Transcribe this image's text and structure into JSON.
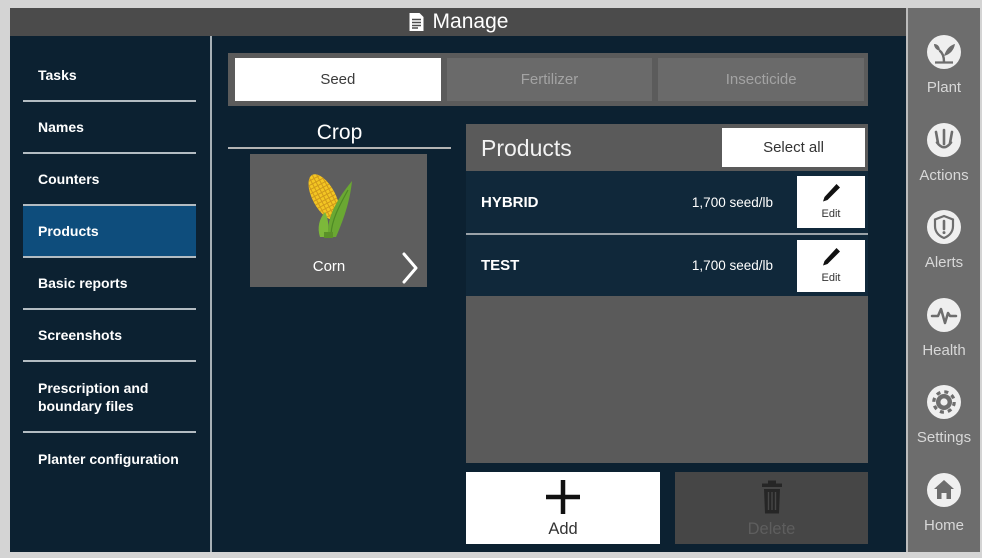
{
  "window": {
    "title": "Manage",
    "title_icon": "document-icon"
  },
  "nav": {
    "items": [
      {
        "label": "Tasks",
        "selected": false
      },
      {
        "label": "Names",
        "selected": false
      },
      {
        "label": "Counters",
        "selected": false
      },
      {
        "label": "Products",
        "selected": true
      },
      {
        "label": "Basic reports",
        "selected": false
      },
      {
        "label": "Screenshots",
        "selected": false
      },
      {
        "label": "Prescription and boundary files",
        "selected": false
      },
      {
        "label": "Planter configuration",
        "selected": false
      }
    ]
  },
  "tabs": [
    {
      "label": "Seed",
      "active": true
    },
    {
      "label": "Fertilizer",
      "active": false
    },
    {
      "label": "Insecticide",
      "active": false
    }
  ],
  "crop": {
    "heading": "Crop",
    "card": {
      "label": "Corn",
      "icon": "corn-icon",
      "chevron_icon": "chevron-right-icon"
    }
  },
  "products": {
    "heading": "Products",
    "select_all_label": "Select all",
    "rows": [
      {
        "name": "HYBRID",
        "rate": "1,700 seed/lb",
        "edit_label": "Edit",
        "edit_icon": "pencil-icon"
      },
      {
        "name": "TEST",
        "rate": "1,700 seed/lb",
        "edit_label": "Edit",
        "edit_icon": "pencil-icon"
      }
    ]
  },
  "actions": {
    "add": {
      "label": "Add",
      "icon": "plus-icon",
      "enabled": true
    },
    "delete": {
      "label": "Delete",
      "icon": "trash-icon",
      "enabled": false
    }
  },
  "sidebar": {
    "items": [
      {
        "label": "Plant",
        "icon": "plant-icon"
      },
      {
        "label": "Actions",
        "icon": "actions-icon"
      },
      {
        "label": "Alerts",
        "icon": "alert-shield-icon"
      },
      {
        "label": "Health",
        "icon": "health-pulse-icon"
      },
      {
        "label": "Settings",
        "icon": "gear-icon"
      },
      {
        "label": "Home",
        "icon": "home-icon"
      }
    ]
  },
  "colors": {
    "background": "#0c2131",
    "nav_selected": "#0e4d7c",
    "panel_gray": "#5a5a5a",
    "sidebar_gray": "#6d6d6d",
    "title_bar": "#4b4b4b",
    "button_white": "#ffffff"
  }
}
